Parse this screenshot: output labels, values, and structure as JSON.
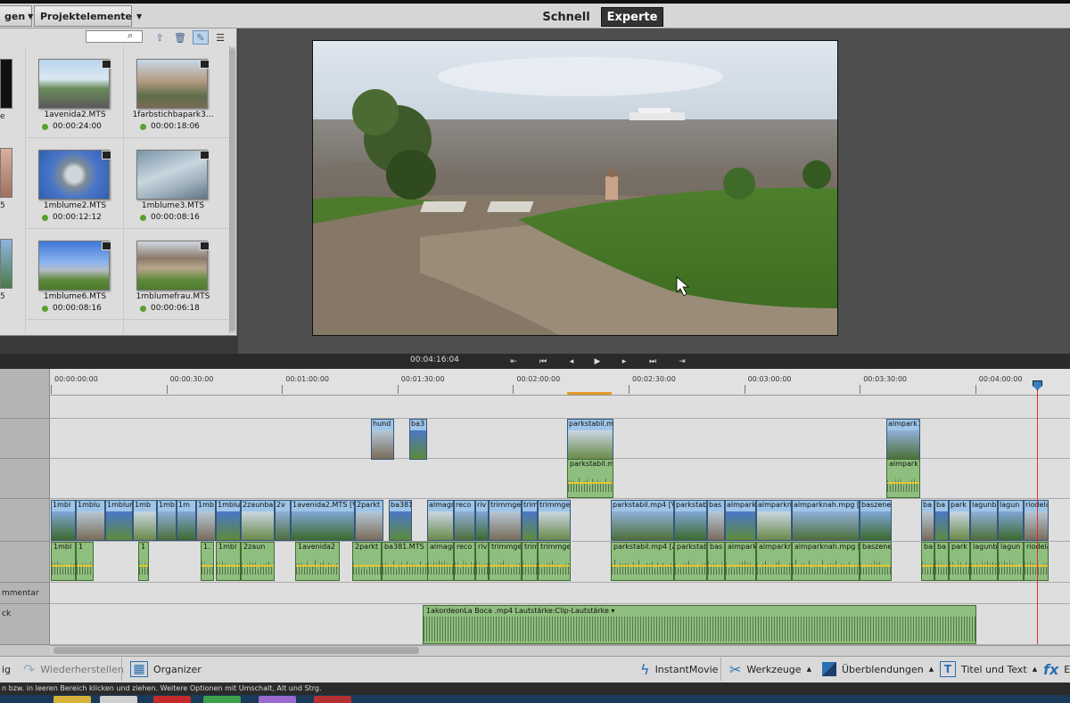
{
  "topbar": {
    "menu_left": "gen",
    "project_elements": "Projektelemente",
    "mode_quick": "Schnell",
    "mode_expert": "Experte"
  },
  "project_panel": {
    "items": [
      {
        "name": "1avenida2.MTS",
        "duration": "00:00:24:00"
      },
      {
        "name": "1farbstichbapark3...",
        "duration": "00:00:18:06"
      },
      {
        "name": "1mblume2.MTS",
        "duration": "00:00:12:12"
      },
      {
        "name": "1mblume3.MTS",
        "duration": "00:00:08:16"
      },
      {
        "name": "1mblume6.MTS",
        "duration": "00:00:08:16"
      },
      {
        "name": "1mblumefrau.MTS",
        "duration": "00:00:06:18"
      }
    ],
    "left_partial": [
      "e",
      "5",
      "5"
    ]
  },
  "transport": {
    "timecode": "00:04:16:04"
  },
  "ruler": {
    "ticks": [
      "00:00:00:00",
      "00:00:30:00",
      "00:01:00:00",
      "00:01:30:00",
      "00:02:00:00",
      "00:02:30:00",
      "00:03:00:00",
      "00:03:30:00",
      "00:04:00:00"
    ]
  },
  "tracks": {
    "comment_label": "mmentar",
    "soundtrack_label": "ck"
  },
  "clips": {
    "overlay_video": [
      "hund",
      "ba3",
      "parkstabil.mp",
      "almpark7..."
    ],
    "overlay_audio": [
      "parkstabil.mp",
      "almpark7..."
    ],
    "main_video": [
      "1mbl",
      "1mblu",
      "1mblum",
      "1mb",
      "1mb",
      "1m",
      "1mb",
      "1mblu",
      "2zaunba",
      "2v",
      "1avenida2.MTS [V]",
      "2parkt",
      "ba381",
      "almagr",
      "reco",
      "riv",
      "trimmger",
      "trim",
      "trimmger",
      "parkstabil.mp4 [V]",
      "parkstabi",
      "bas",
      "almpark",
      "almparkn",
      "almparknah.mpg [V]",
      "baszene",
      "ba",
      "ba",
      "park",
      "lagunb",
      "lagun",
      "riodela"
    ],
    "main_audio": [
      "1mbl",
      "1",
      "1",
      "1.",
      "1mbl",
      "2zaun",
      "1avenida2",
      "2parkt",
      "ba381.MTS [A]",
      "almagr",
      "reco",
      "riv",
      "trimmger",
      "trim",
      "trimmger",
      "parkstabil.mp4 [A]",
      "parkstabi",
      "bas",
      "almpark",
      "almparkn",
      "almparknah.mpg [A]",
      "baszene",
      "ba",
      "ba",
      "park",
      "lagunb",
      "lagun",
      "riodela"
    ],
    "soundtrack_clip": "1akordeonLa Boca .mp4  Lautstärke:Clip-Lautstärke ▾"
  },
  "bottombar": {
    "undo": "ig",
    "redo": "Wiederherstellen",
    "organizer": "Organizer",
    "instantmovie": "InstantMovie",
    "tools": "Werkzeuge",
    "transitions": "Überblendungen",
    "titles": "Titel und Text",
    "fx": "E"
  },
  "status": "n bzw. in leeren Bereich klicken und ziehen. Weitere Optionen mit Umschalt, Alt und Strg.",
  "colors": {
    "video_clip": "#9ec5e8",
    "audio_clip": "#8fbf7e",
    "playhead": "#e03030",
    "accent": "#2a6fb3"
  }
}
